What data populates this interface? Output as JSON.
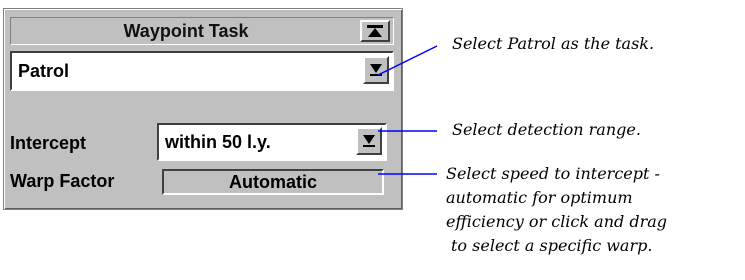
{
  "panel": {
    "title": "Waypoint Task",
    "task_value": "Patrol",
    "intercept_label": "Intercept",
    "intercept_value": "within 50 l.y.",
    "warp_label": "Warp Factor",
    "warp_value": "Automatic"
  },
  "annotations": {
    "task": "Select Patrol as the task.",
    "range": "Select detection range.",
    "speed_lines": [
      "Select speed to intercept -",
      "automatic for optimum",
      "efficiency or click and drag",
      "to select a specific warp."
    ]
  },
  "colors": {
    "panel_bg": "#c0c0c0",
    "leader_line": "#0000ff"
  },
  "icons": {
    "collapse": "collapse-up-icon",
    "dropdown": "dropdown-arrow-icon"
  }
}
